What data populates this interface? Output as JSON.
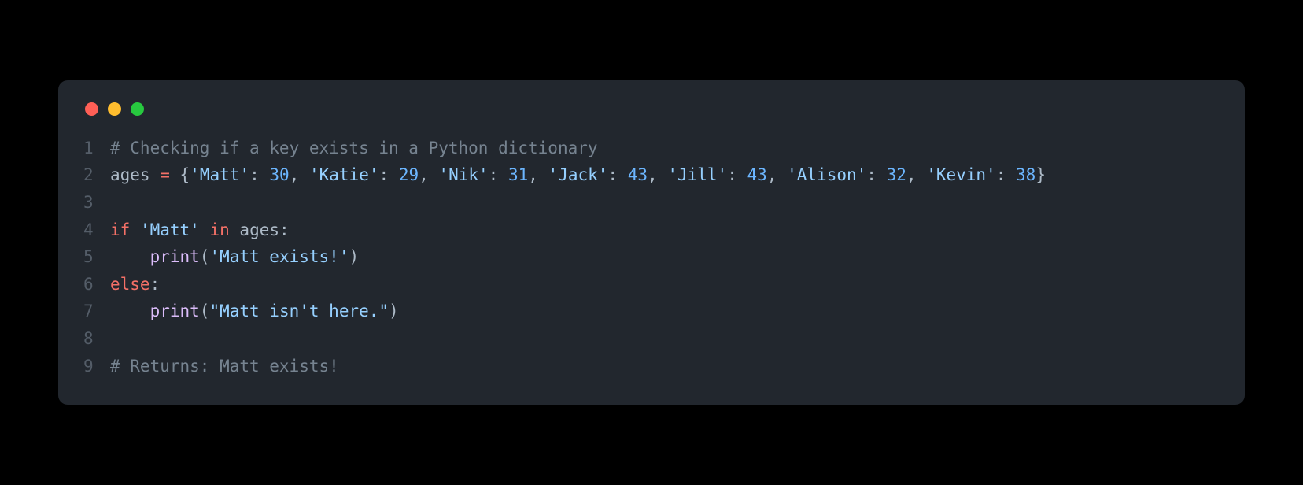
{
  "colors": {
    "traffic_red": "#ff5f56",
    "traffic_yellow": "#ffbd2e",
    "traffic_green": "#27c93f",
    "bg_black": "#000000",
    "window_bg": "#22272e",
    "gutter": "#545d68",
    "comment": "#768390",
    "ident": "#adbac7",
    "operator": "#f47067",
    "keyword": "#f47067",
    "string": "#96d0ff",
    "number": "#6cb6ff",
    "function": "#dcbdfb"
  },
  "lineNumbers": [
    "1",
    "2",
    "3",
    "4",
    "5",
    "6",
    "7",
    "8",
    "9"
  ],
  "code": {
    "l1": {
      "comment": "# Checking if a key exists in a Python dictionary"
    },
    "l2": {
      "var": "ages",
      "sp1": " ",
      "eq": "=",
      "sp2": " ",
      "ob": "{",
      "k1": "'Matt'",
      "c1": ":",
      "s1": " ",
      "v1": "30",
      "d1": ",",
      "sp3": " ",
      "k2": "'Katie'",
      "c2": ":",
      "s2": " ",
      "v2": "29",
      "d2": ",",
      "sp4": " ",
      "k3": "'Nik'",
      "c3": ":",
      "s3": " ",
      "v3": "31",
      "d3": ",",
      "sp5": " ",
      "k4": "'Jack'",
      "c4": ":",
      "s4": " ",
      "v4": "43",
      "d4": ",",
      "sp6": " ",
      "k5": "'Jill'",
      "c5": ":",
      "s5": " ",
      "v5": "43",
      "d5": ",",
      "sp7": " ",
      "k6": "'Alison'",
      "c6": ":",
      "s6": " ",
      "v6": "32",
      "d6": ",",
      "sp8": " ",
      "k7": "'Kevin'",
      "c7": ":",
      "s7": " ",
      "v7": "38",
      "cb": "}"
    },
    "l4": {
      "kw_if": "if",
      "sp1": " ",
      "str": "'Matt'",
      "sp2": " ",
      "kw_in": "in",
      "sp3": " ",
      "var": "ages",
      "colon": ":"
    },
    "l5": {
      "indent": "    ",
      "fn": "print",
      "op": "(",
      "str": "'Matt exists!'",
      "cp": ")"
    },
    "l6": {
      "kw_else": "else",
      "colon": ":"
    },
    "l7": {
      "indent": "    ",
      "fn": "print",
      "op": "(",
      "str": "\"Matt isn't here.\"",
      "cp": ")"
    },
    "l9": {
      "comment": "# Returns: Matt exists!"
    }
  }
}
